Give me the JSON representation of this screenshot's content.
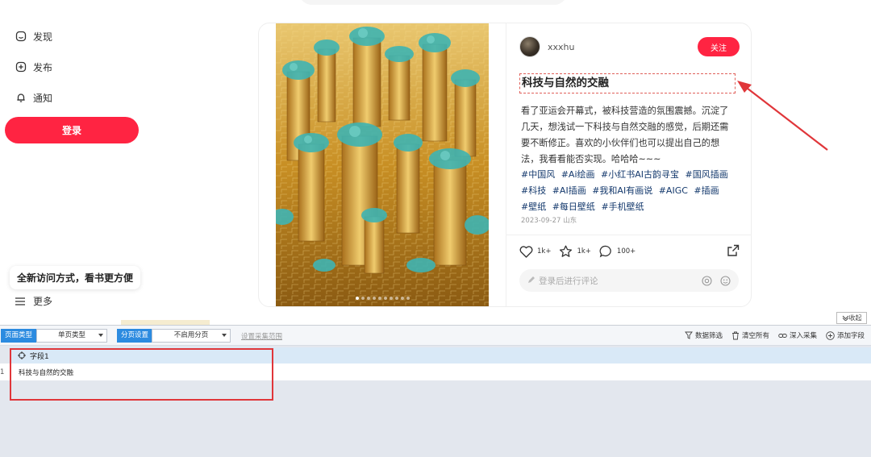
{
  "sidebar": {
    "items": [
      {
        "label": "发现",
        "icon": "discover-icon"
      },
      {
        "label": "发布",
        "icon": "publish-icon"
      },
      {
        "label": "通知",
        "icon": "bell-icon"
      }
    ],
    "login_label": "登录",
    "tip": "全新访问方式，看书更方便",
    "more_label": "更多"
  },
  "note": {
    "author": "xxxhu",
    "follow_label": "关注",
    "title": "科技与自然的交融",
    "description": "看了亚运会开幕式，被科技营造的氛围震撼。沉淀了几天，想浅试一下科技与自然交融的感觉，后期还需要不断修正。喜欢的小伙伴们也可以提出自己的想法，我看看能否实现。哈哈哈~~~",
    "tags": [
      "#中国风",
      "#Ai绘画",
      "#小红书AI古韵寻宝",
      "#国风插画",
      "#科技",
      "#AI插画",
      "#我和AI有画说",
      "#AIGC",
      "#插画",
      "#壁纸",
      "#每日壁纸",
      "#手机壁纸"
    ],
    "date": "2023-09-27 山东",
    "likes": "1k+",
    "collects": "1k+",
    "comments": "100+",
    "comment_placeholder": "登录后进行评论",
    "image_pages": 10,
    "active_page": 0
  },
  "tool": {
    "collapse_label": "收起",
    "page_type_label": "页面类型",
    "page_type_value": "单页类型",
    "pagination_label": "分页设置",
    "pagination_value": "不启用分页",
    "range_link": "设置采集范围",
    "actions": [
      {
        "label": "数据筛选",
        "icon": "filter-icon"
      },
      {
        "label": "清空所有",
        "icon": "trash-icon"
      },
      {
        "label": "深入采集",
        "icon": "link-icon"
      },
      {
        "label": "添加字段",
        "icon": "add-circle-icon"
      }
    ],
    "field_header": "字段1",
    "rows": [
      {
        "num": "1",
        "value": "科技与自然的交融"
      }
    ]
  },
  "colors": {
    "brand": "#ff2442",
    "tag": "#13386c",
    "tool_accent": "#2c8be0",
    "annotation": "#e0363a"
  }
}
